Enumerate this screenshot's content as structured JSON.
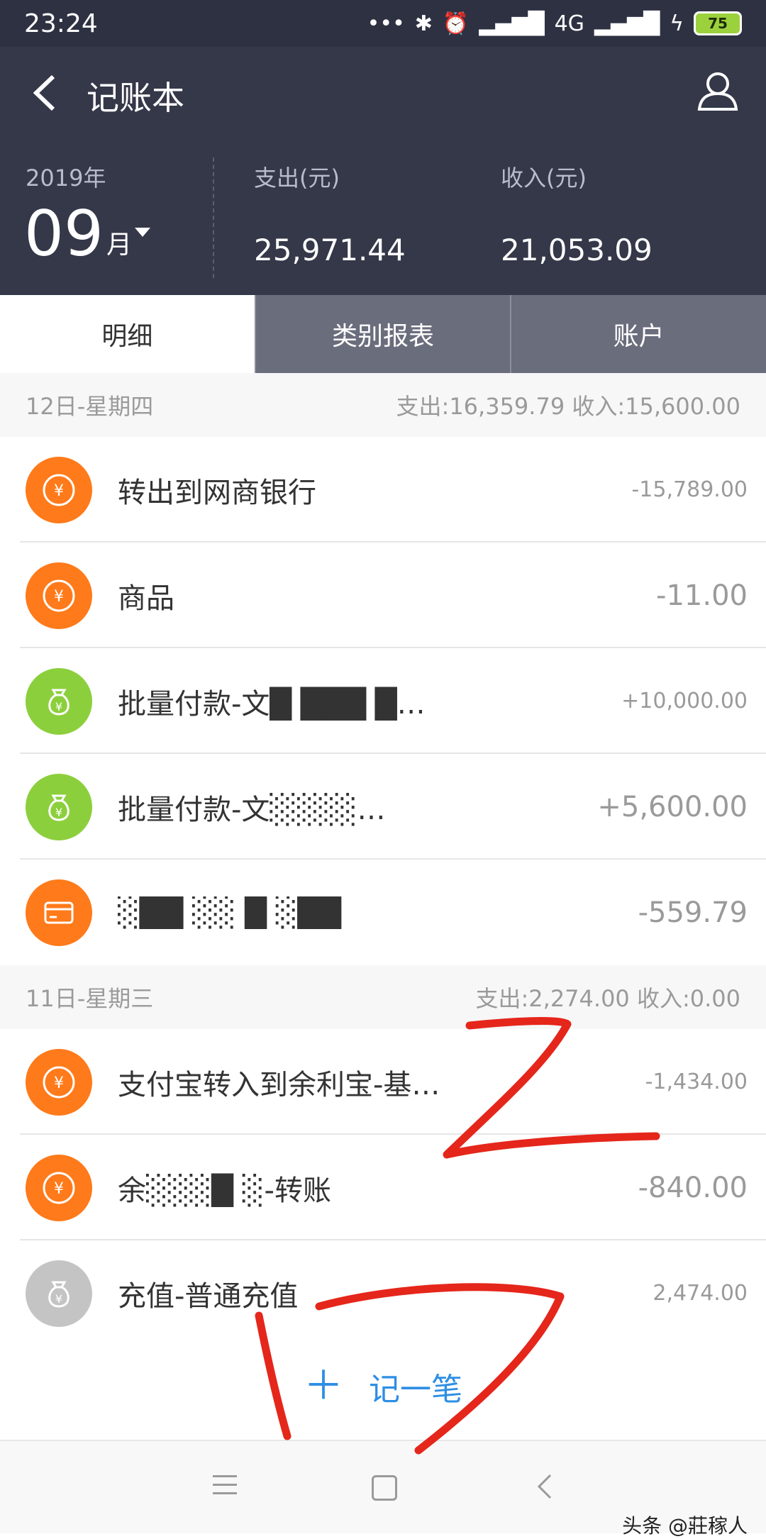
{
  "status_bar": {
    "time": "23:24",
    "network": "4G",
    "battery": "75"
  },
  "header": {
    "title": "记账本",
    "year": "2019年",
    "month": "09",
    "month_unit": "月",
    "expense_label": "支出(元)",
    "expense_value": "25,971.44",
    "income_label": "收入(元)",
    "income_value": "21,053.09"
  },
  "tabs": [
    {
      "label": "明细",
      "active": true
    },
    {
      "label": "类别报表",
      "active": false
    },
    {
      "label": "账户",
      "active": false
    }
  ],
  "groups": [
    {
      "date": "12日-星期四",
      "summary": "支出:16,359.79 收入:15,600.00",
      "items": [
        {
          "icon": "yuan-coin-icon",
          "label": "转出到网商银行",
          "amount": "-15,789.00"
        },
        {
          "icon": "yuan-coin-icon",
          "label": "商品",
          "amount": "-11.00"
        },
        {
          "icon": "money-bag-icon",
          "label": "批量付款-文█ ███ █…",
          "amount": "+10,000.00"
        },
        {
          "icon": "money-bag-icon",
          "label": "批量付款-文░░░░…",
          "amount": "+5,600.00"
        },
        {
          "icon": "bank-card-icon",
          "label": "░██ ░░ █ ░██",
          "amount": "-559.79"
        }
      ]
    },
    {
      "date": "11日-星期三",
      "summary": "支出:2,274.00 收入:0.00",
      "items": [
        {
          "icon": "yuan-coin-icon",
          "label": "支付宝转入到余利宝-基…",
          "amount": "-1,434.00"
        },
        {
          "icon": "yuan-coin-icon",
          "label": "余░░░█ ░-转账",
          "amount": "-840.00"
        },
        {
          "icon": "money-bag-icon",
          "label": "充值-普通充值",
          "amount": "2,474.00"
        }
      ]
    }
  ],
  "add_button": {
    "label": "记一笔"
  },
  "watermark": "头条 @莊稼人"
}
